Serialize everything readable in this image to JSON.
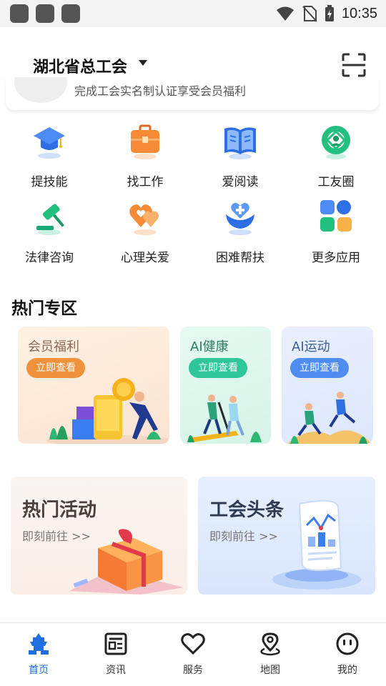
{
  "status_bar": {
    "time": "10:35",
    "icons": [
      "app-icon-1",
      "app-icon-2",
      "app-icon-3",
      "wifi-icon",
      "no-sim-icon",
      "battery-charging-icon"
    ]
  },
  "header": {
    "title": "湖北省总工会",
    "scan_icon": "scan-icon"
  },
  "notice": {
    "text": "完成工会实名制认证享受会员福利"
  },
  "apps": [
    {
      "label": "提技能",
      "icon": "graduation-cap-icon"
    },
    {
      "label": "找工作",
      "icon": "briefcase-icon"
    },
    {
      "label": "爱阅读",
      "icon": "open-book-icon"
    },
    {
      "label": "工友圈",
      "icon": "camera-aperture-icon"
    },
    {
      "label": "法律咨询",
      "icon": "gavel-icon"
    },
    {
      "label": "心理关爱",
      "icon": "hearts-icon"
    },
    {
      "label": "困难帮扶",
      "icon": "helping-hand-icon"
    },
    {
      "label": "更多应用",
      "icon": "app-grid-icon"
    }
  ],
  "hot_zone": {
    "title": "热门专区",
    "cards": [
      {
        "title": "会员福利",
        "button": "立即查看",
        "accent": "#f0923b"
      },
      {
        "title": "AI健康",
        "button": "立即查看",
        "accent": "#2fc79a"
      },
      {
        "title": "AI运动",
        "button": "立即查看",
        "accent": "#4f8df0"
      }
    ]
  },
  "banners": [
    {
      "title": "热门活动",
      "subtitle": "即刻前往 >>"
    },
    {
      "title": "工会头条",
      "subtitle": "即刻前往 >>"
    }
  ],
  "tabs": [
    {
      "label": "首页",
      "icon": "home-tower-icon",
      "active": true
    },
    {
      "label": "资讯",
      "icon": "news-icon",
      "active": false
    },
    {
      "label": "服务",
      "icon": "heart-outline-icon",
      "active": false
    },
    {
      "label": "地图",
      "icon": "map-pin-icon",
      "active": false
    },
    {
      "label": "我的",
      "icon": "face-icon",
      "active": false
    }
  ],
  "colors": {
    "primary": "#1f6fe0",
    "text": "#1a1a1a"
  }
}
